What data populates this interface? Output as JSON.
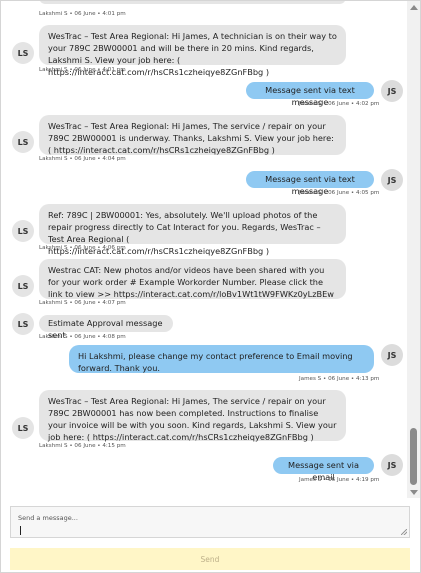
{
  "thread": {
    "top_meta": "Lakshmi S • 06 June • 4:01 pm",
    "messages": [
      {
        "dir": "in",
        "avatar": "LS",
        "text": "WesTrac – Test Area Regional: Hi James, A technician is on their way to your 789C 2BW00001 and will be there in 20 mins. Kind regards, Lakshmi S. View your job here: ( https://interact.cat.com/r/hsCRs1czheiqye8ZGnFBbg )",
        "meta": "Lakshmi S • 06 June • 4:01 pm"
      },
      {
        "dir": "out",
        "avatar": "JS",
        "text": "Message sent via text message",
        "meta": "James S • 06 June • 4:02 pm"
      },
      {
        "dir": "in",
        "avatar": "LS",
        "text": "WesTrac – Test Area Regional: Hi James, The service / repair on your 789C 2BW00001 is underway. Thanks, Lakshmi S. View your job here: ( https://interact.cat.com/r/hsCRs1czheiqye8ZGnFBbg )",
        "meta": "Lakshmi S • 06 June • 4:04 pm"
      },
      {
        "dir": "out",
        "avatar": "JS",
        "text": "Message sent via text message",
        "meta": "James S • 06 June • 4:05 pm"
      },
      {
        "dir": "in",
        "avatar": "LS",
        "text": "Ref: 789C | 2BW00001: Yes, absolutely. We'll upload photos of the repair progress directly to Cat Interact for you. Regards, WesTrac – Test Area Regional ( https://interact.cat.com/r/hsCRs1czheiqye8ZGnFBbg )",
        "meta": "Lakshmi S • 06 June • 4:06 pm"
      },
      {
        "dir": "in",
        "avatar": "LS",
        "text": "Westrac CAT: New photos and/or videos have been shared with you for your work order # Example Workorder Number. Please click the link to view >> https://interact.cat.com/r/loBv1Wt1tW9FWKz0yLzBEw",
        "meta": "Lakshmi S • 06 June • 4:07 pm"
      },
      {
        "dir": "in",
        "avatar": "LS",
        "text": "Estimate Approval message sent",
        "meta": "Lakshmi S • 06 June • 4:08 pm"
      },
      {
        "dir": "out",
        "avatar": "JS",
        "text": "Hi Lakshmi, please change my contact preference to Email moving forward. Thank you.",
        "meta": "James S • 06 June • 4:13 pm"
      },
      {
        "dir": "in",
        "avatar": "LS",
        "text": "WesTrac – Test Area Regional: Hi James, The service / repair on your 789C 2BW00001 has now been completed. Instructions to finalise your invoice will be with you soon. Kind regards, Lakshmi S. View your job here: ( https://interact.cat.com/r/hsCRs1czheiqye8ZGnFBbg )",
        "meta": "Lakshmi S • 06 June • 4:15 pm"
      },
      {
        "dir": "out",
        "avatar": "JS",
        "text": "Message sent via email",
        "meta": "James S • 06 June • 4:19 pm"
      }
    ]
  },
  "composer": {
    "placeholder": "Send a message..."
  },
  "send_label": "Send",
  "colors": {
    "incoming": "#e5e5e5",
    "outgoing": "#8fc9f2",
    "send_bg": "#fff6c7"
  }
}
